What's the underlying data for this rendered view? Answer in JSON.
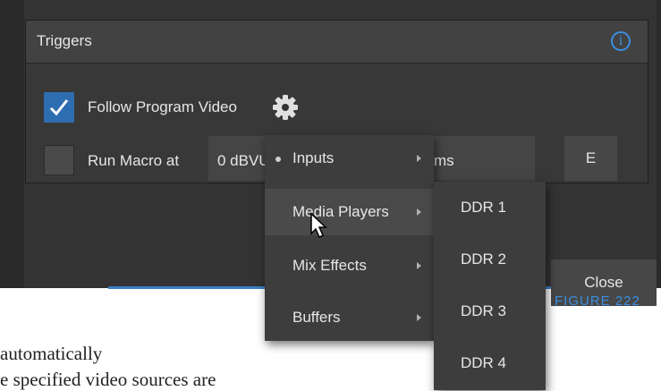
{
  "panel": {
    "title": "Triggers",
    "info_icon_glyph": "i",
    "follow_checkbox": {
      "label": "Follow Program Video",
      "checked": true
    },
    "macro_checkbox": {
      "label": "Run Macro at",
      "checked": false
    },
    "level_value": "0 dBVU",
    "level_suffix": "ms",
    "e_button_label": "E",
    "close_button_label": "Close"
  },
  "context_menu": {
    "items": [
      {
        "label": "Inputs"
      },
      {
        "label": "Media Players"
      },
      {
        "label": "Mix Effects"
      },
      {
        "label": "Buffers"
      }
    ],
    "submenu": [
      "DDR 1",
      "DDR 2",
      "DDR 3",
      "DDR 4"
    ]
  },
  "figure_caption": "FIGURE 222",
  "body_text": {
    "line1": "automatically",
    "line2": "e specified video sources are"
  },
  "colors": {
    "accent": "#3b8fe0",
    "checkbox": "#2f6db1"
  }
}
